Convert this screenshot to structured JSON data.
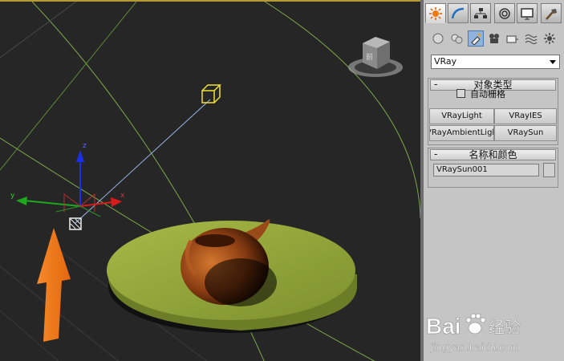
{
  "viewport": {
    "viewcube_face": "前",
    "axis_labels": {
      "x": "x",
      "y": "y",
      "z": "z"
    }
  },
  "command_panel": {
    "tabs": [
      "create-tab",
      "modify-tab",
      "hierarchy-tab",
      "motion-tab",
      "display-tab",
      "utilities-tab"
    ],
    "categories": [
      "geometry",
      "shapes",
      "lights",
      "cameras",
      "helpers",
      "space-warps",
      "systems"
    ],
    "renderer_dropdown": {
      "value": "VRay"
    },
    "object_type": {
      "title": "对象类型",
      "autogrid_label": "自动栅格",
      "autogrid_checked": false,
      "buttons": [
        "VRayLight",
        "VRayIES",
        "VRayAmbientLight",
        "VRaySun"
      ]
    },
    "name_color": {
      "title": "名称和颜色",
      "name_value": "VRaySun001",
      "color": "#d0d0d0"
    }
  },
  "watermark": {
    "logo_text": "Bai",
    "logo_text2": "经验",
    "url": "jingyan.baidu.com"
  },
  "colors": {
    "viewport_bg": "#262626",
    "plate": "#8fa03b",
    "teapot": "#a5541f",
    "arrow": "#f07a1c",
    "sun_target": "#f0e030",
    "grid_line": "#7ea84a"
  }
}
